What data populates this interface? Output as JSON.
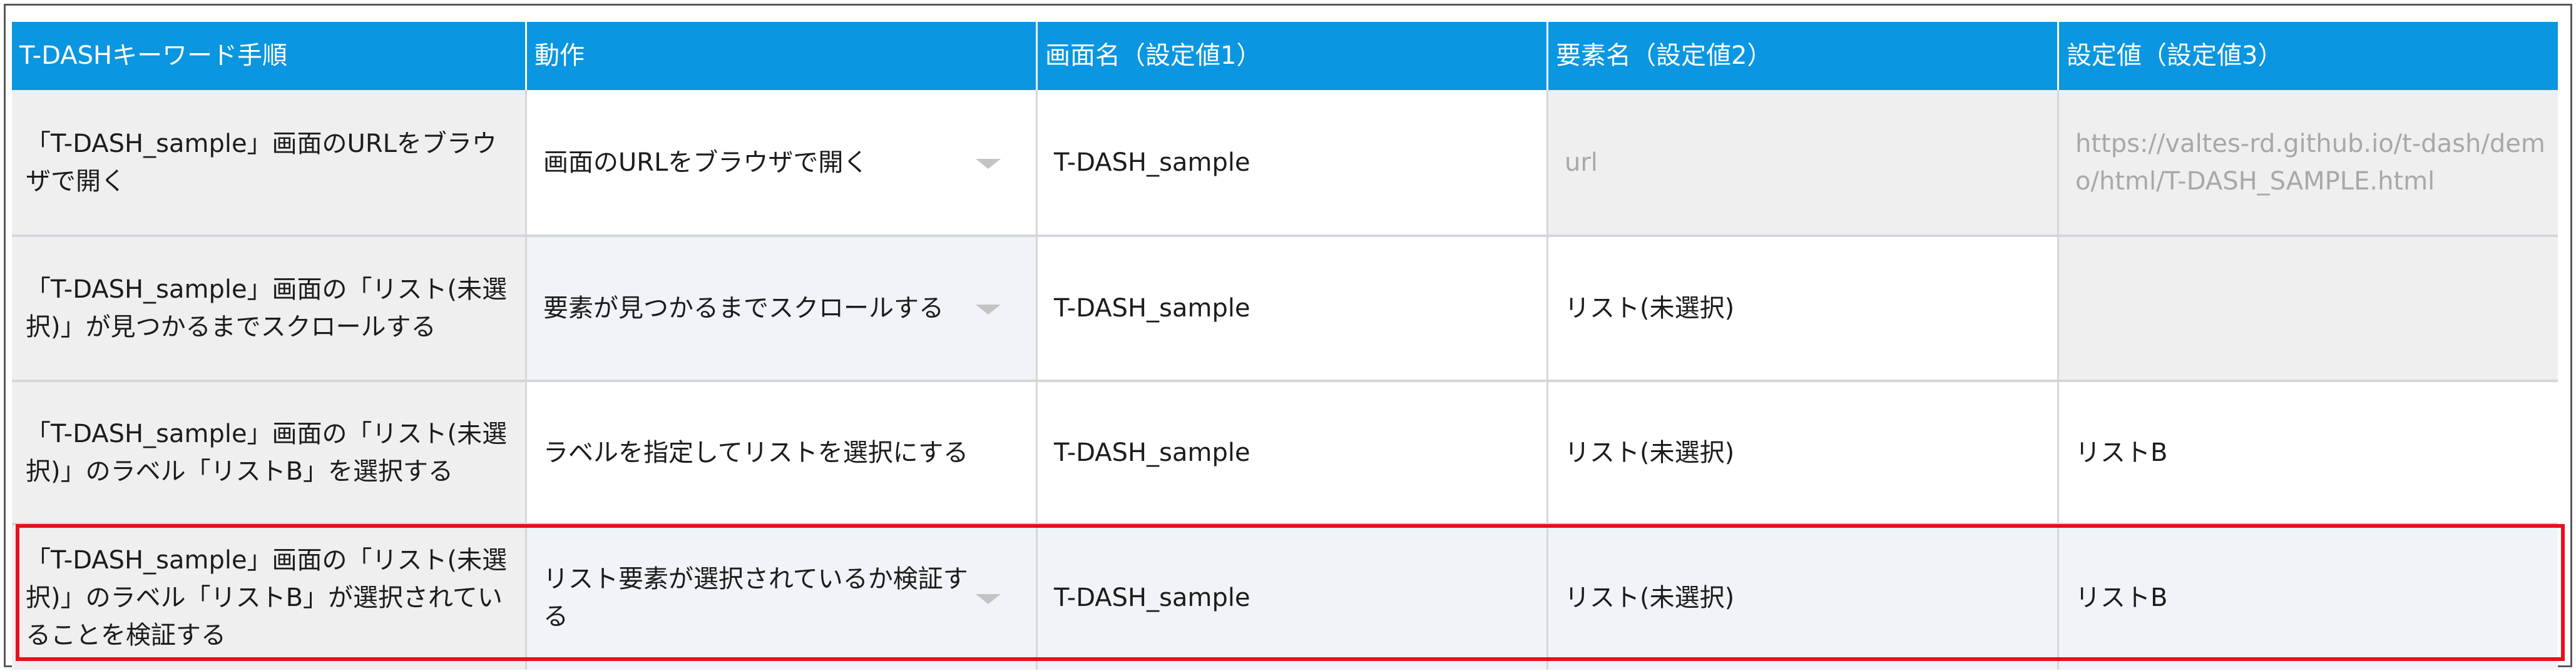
{
  "headers": {
    "step": "T-DASHキーワード手順",
    "action": "動作",
    "screen": "画面名（設定値1）",
    "element": "要素名（設定値2）",
    "value": "設定値（設定値3）"
  },
  "rows": [
    {
      "step": "「T-DASH_sample」画面のURLをブラウザで開く",
      "action": "画面のURLをブラウザで開く",
      "screen": "T-DASH_sample",
      "element": "url",
      "value": "https://valtes-rd.github.io/t-dash/demo/html/T-DASH_SAMPLE.html"
    },
    {
      "step": "「T-DASH_sample」画面の「リスト(未選択)」が見つかるまでスクロールする",
      "action": "要素が見つかるまでスクロールする",
      "screen": "T-DASH_sample",
      "element": "リスト(未選択)",
      "value": ""
    },
    {
      "step": "「T-DASH_sample」画面の「リスト(未選択)」のラベル「リストB」を選択する",
      "action": "ラベルを指定してリストを選択にする",
      "screen": "T-DASH_sample",
      "element": "リスト(未選択)",
      "value": "リストB"
    },
    {
      "step": "「T-DASH_sample」画面の「リスト(未選択)」のラベル「リストB」が選択されていることを検証する",
      "action": "リスト要素が選択されているか検証する",
      "screen": "T-DASH_sample",
      "element": "リスト(未選択)",
      "value": "リストB"
    }
  ],
  "colors": {
    "header_bg": "#0a96e0",
    "highlight_border": "#e8101a",
    "placeholder_text": "#a8a8a8"
  }
}
